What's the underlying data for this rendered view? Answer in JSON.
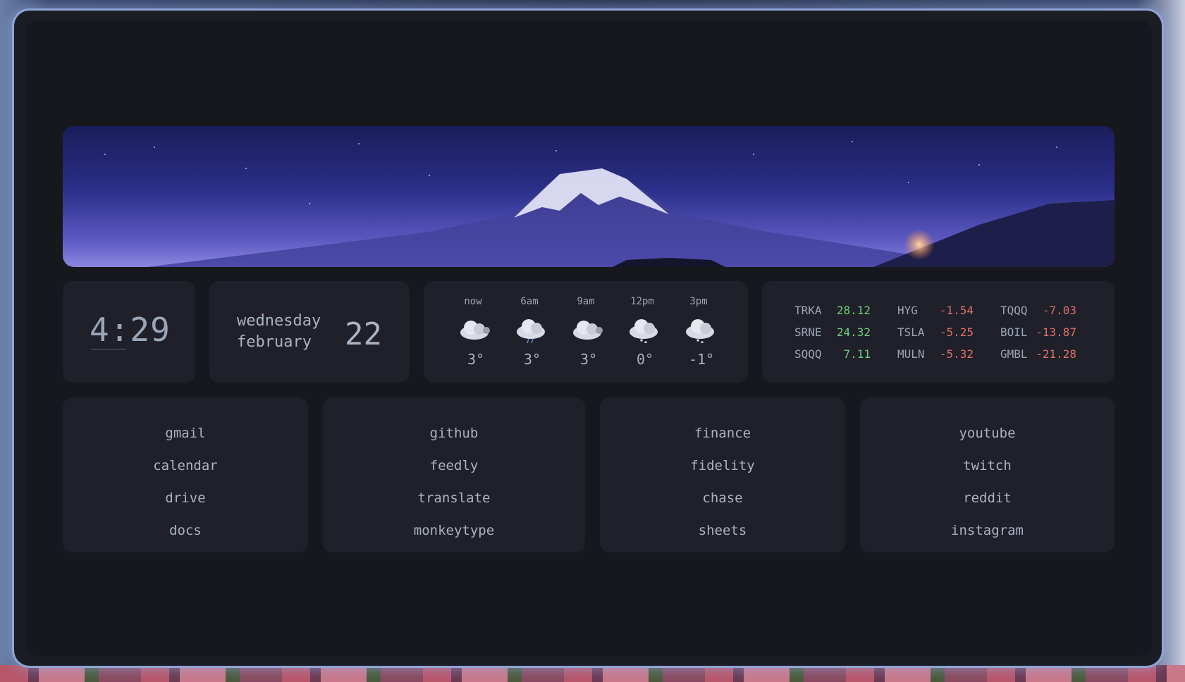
{
  "clock": {
    "time": "4:29"
  },
  "date": {
    "weekday": "wednesday",
    "month": "february",
    "day": "22"
  },
  "weather": [
    {
      "label": "now",
      "icon": "cloud-icon",
      "temp": "3°"
    },
    {
      "label": "6am",
      "icon": "rain-cloud-icon",
      "temp": "3°"
    },
    {
      "label": "9am",
      "icon": "cloud-icon",
      "temp": "3°"
    },
    {
      "label": "12pm",
      "icon": "snow-cloud-icon",
      "temp": "0°"
    },
    {
      "label": "3pm",
      "icon": "snow-cloud-icon",
      "temp": "-1°"
    }
  ],
  "stocks": [
    {
      "symbol": "TRKA",
      "value": "28.12",
      "trend": "up"
    },
    {
      "symbol": "SRNE",
      "value": "24.32",
      "trend": "up"
    },
    {
      "symbol": "SQQQ",
      "value": "7.11",
      "trend": "up"
    },
    {
      "symbol": "HYG",
      "value": "-1.54",
      "trend": "down"
    },
    {
      "symbol": "TSLA",
      "value": "-5.25",
      "trend": "down"
    },
    {
      "symbol": "MULN",
      "value": "-5.32",
      "trend": "down"
    },
    {
      "symbol": "TQQQ",
      "value": "-7.03",
      "trend": "down"
    },
    {
      "symbol": "BOIL",
      "value": "-13.87",
      "trend": "down"
    },
    {
      "symbol": "GMBL",
      "value": "-21.28",
      "trend": "down"
    }
  ],
  "links": [
    [
      "gmail",
      "calendar",
      "drive",
      "docs"
    ],
    [
      "github",
      "feedly",
      "translate",
      "monkeytype"
    ],
    [
      "finance",
      "fidelity",
      "chase",
      "sheets"
    ],
    [
      "youtube",
      "twitch",
      "reddit",
      "instagram"
    ]
  ],
  "colors": {
    "up": "#6ed07a",
    "down": "#e0706a",
    "text": "#a9b3c3",
    "card": "#1f2029"
  }
}
